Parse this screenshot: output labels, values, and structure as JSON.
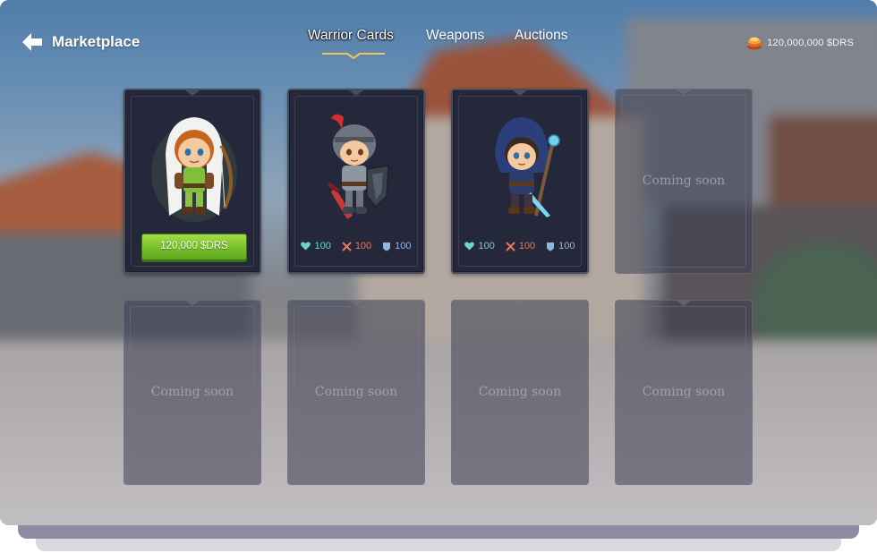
{
  "header": {
    "back_label": "Marketplace",
    "back_icon": "arrow-left-icon",
    "tabs": [
      {
        "label": "Warrior Cards",
        "active": true
      },
      {
        "label": "Weapons",
        "active": false
      },
      {
        "label": "Auctions",
        "active": false
      }
    ],
    "balance": "120,000,000 $DRS",
    "balance_icon": "coin-stack-icon"
  },
  "cards": [
    {
      "type": "warrior",
      "character": "hooded-archer",
      "price_label": "120,000 $DRS"
    },
    {
      "type": "warrior",
      "character": "armored-knight",
      "stats": {
        "health": "100",
        "attack": "100",
        "defense": "100"
      }
    },
    {
      "type": "warrior",
      "character": "hooded-mage",
      "stats": {
        "health": "100",
        "attack": "100",
        "defense": "100"
      }
    },
    {
      "type": "empty",
      "label": "Coming soon"
    },
    {
      "type": "empty",
      "label": "Coming soon"
    },
    {
      "type": "empty",
      "label": "Coming soon"
    },
    {
      "type": "empty",
      "label": "Coming soon"
    },
    {
      "type": "empty",
      "label": "Coming soon"
    }
  ],
  "colors": {
    "buy_button": "#7cc12c",
    "health": "#6fd3cf",
    "attack": "#e57a60",
    "defense": "#8fb7e0",
    "card_bg": "#24283a"
  }
}
